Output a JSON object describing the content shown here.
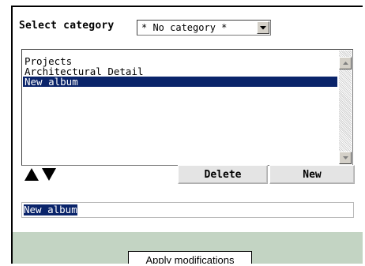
{
  "category": {
    "label": "Select category",
    "selected_value": "* No category *"
  },
  "album_list": {
    "items": [
      {
        "label": "Projects",
        "selected": false
      },
      {
        "label": "Architectural Detail",
        "selected": false
      },
      {
        "label": "New album",
        "selected": true
      }
    ]
  },
  "toolbar": {
    "move_up_icon": "triangle-up",
    "move_down_icon": "triangle-down",
    "delete_label": "Delete",
    "new_label": "New"
  },
  "name_field": {
    "value": "New album"
  },
  "footer": {
    "apply_label": "Apply modifications",
    "background": "#c3d4c3"
  },
  "colors": {
    "selection": "#0a246a",
    "button_face": "#e4e4e4"
  }
}
